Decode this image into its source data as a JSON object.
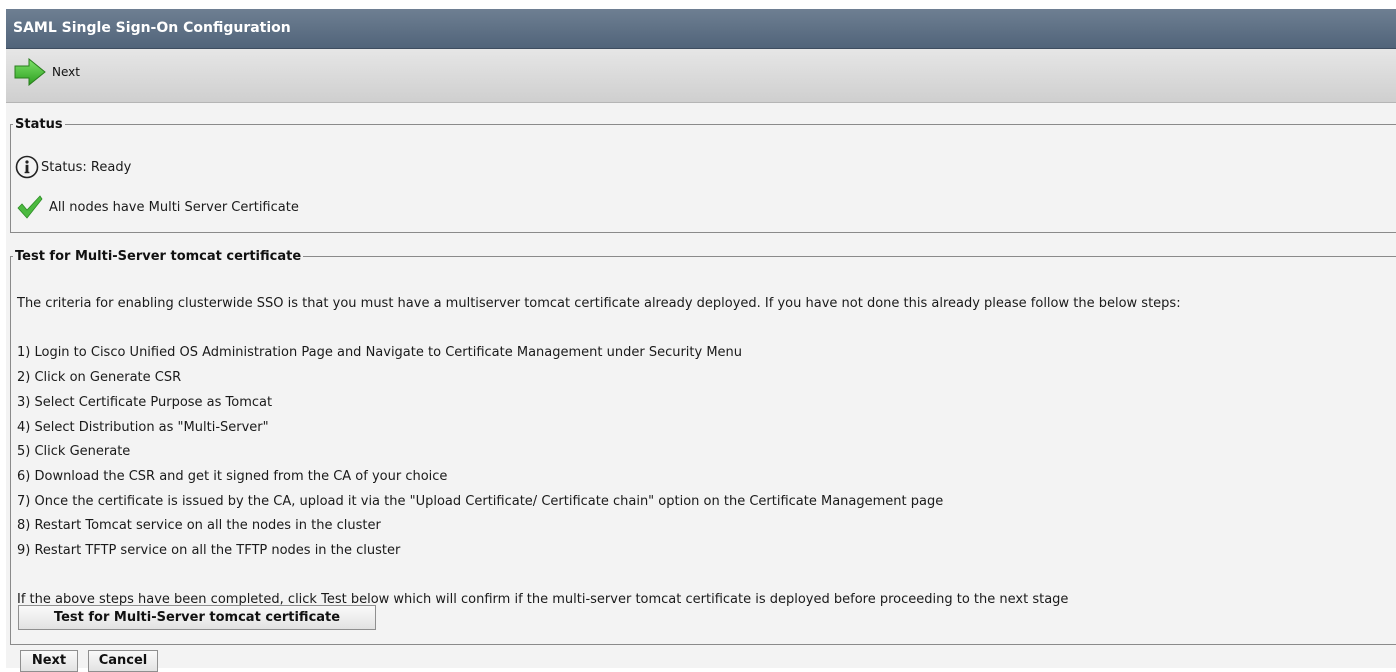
{
  "window": {
    "title": "SAML Single Sign-On Configuration"
  },
  "toolbar": {
    "next_label": "Next"
  },
  "status_section": {
    "legend": "Status",
    "status_text": "Status: Ready",
    "cert_text": "All nodes have Multi Server Certificate"
  },
  "test_section": {
    "legend": "Test for Multi-Server tomcat certificate",
    "intro": "The criteria for enabling clusterwide SSO is that you must have a multiserver tomcat certificate already deployed. If you have not done this already please follow the below steps:",
    "steps": [
      "1) Login to Cisco Unified OS Administration Page and Navigate to Certificate Management under Security Menu",
      "2) Click on Generate CSR",
      "3) Select Certificate Purpose as Tomcat",
      "4) Select Distribution as \"Multi-Server\"",
      "5) Click Generate",
      "6) Download the CSR and get it signed from the CA of your choice",
      "7) Once the certificate is issued by the CA, upload it via the \"Upload Certificate/ Certificate chain\" option on the Certificate Management page",
      "8) Restart Tomcat service on all the nodes in the cluster",
      "9) Restart TFTP service on all the TFTP nodes in the cluster"
    ],
    "footer": "If the above steps have been completed, click Test below which will confirm if the multi-server tomcat certificate is deployed before proceeding to the next stage",
    "test_button": "Test for Multi-Server tomcat certificate"
  },
  "bottom_buttons": {
    "next": "Next",
    "cancel": "Cancel"
  },
  "icons": {
    "next": "next-arrow-icon",
    "info": "info-icon",
    "check": "checkmark-icon"
  },
  "colors": {
    "titlebar": "#5a6c82",
    "arrow": "#3dbb2e",
    "check": "#3aa33a"
  }
}
